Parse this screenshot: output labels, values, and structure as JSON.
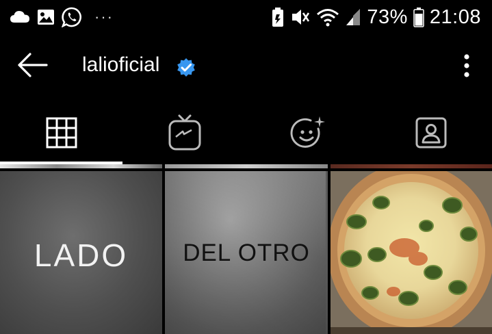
{
  "status_bar": {
    "icons_left": [
      "cloud-icon",
      "image-icon",
      "whatsapp-icon",
      "more-notifications-icon"
    ],
    "overflow": "···",
    "icons_right": [
      "battery-saver-icon",
      "mute-icon",
      "wifi-icon",
      "signal-icon",
      "battery-icon"
    ],
    "battery": "73%",
    "time": "21:08"
  },
  "header": {
    "username": "lalioficial",
    "verified": true,
    "back_icon": "arrow-left-icon",
    "more_icon": "more-vertical-icon"
  },
  "tabs": [
    {
      "name": "tab-grid",
      "icon": "grid-icon",
      "active": true
    },
    {
      "name": "tab-igtv",
      "icon": "igtv-icon",
      "active": false
    },
    {
      "name": "tab-effects",
      "icon": "effects-face-icon",
      "active": false
    },
    {
      "name": "tab-tagged",
      "icon": "tagged-user-icon",
      "active": false
    }
  ],
  "posts": [
    {
      "name": "post-lado",
      "text": "LADO"
    },
    {
      "name": "post-del-otro",
      "text": "DEL OTRO"
    },
    {
      "name": "post-quiche",
      "text": ""
    }
  ],
  "colors": {
    "background": "#000000",
    "appbar": "#000000",
    "verified_blue": "#3897f0",
    "icon": "#ffffff"
  }
}
